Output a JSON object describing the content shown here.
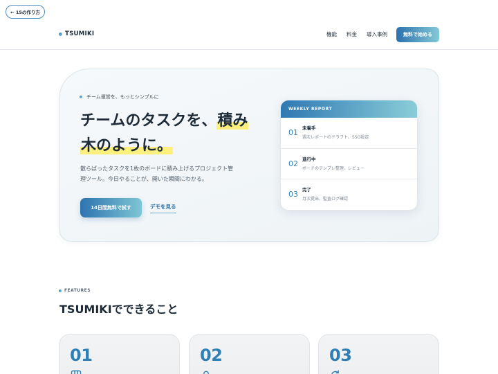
{
  "back_link": {
    "label": "← 15の作り方"
  },
  "header": {
    "logo": "TSUMIKI",
    "nav": [
      {
        "label": "機能"
      },
      {
        "label": "料金"
      },
      {
        "label": "導入事例"
      }
    ],
    "cta_label": "無料で始める"
  },
  "hero": {
    "eyebrow": "チーム運営を、もっとシンプルに",
    "headline": {
      "line1": "チームのタスクを、",
      "line1_highlight": "積み",
      "line2_highlight": "木のように。"
    },
    "description": "散らばったタスクを1枚のボードに積み上げるプロジェクト管理ツール。今日やることが、開いた瞬間にわかる。",
    "primary_cta": "14日間無料で試す",
    "secondary_cta": "デモを見る"
  },
  "weekly_report": {
    "title": "WEEKLY REPORT",
    "rows": [
      {
        "number": "01",
        "status": "未着手",
        "detail": "週次レポートのドラフト、SSO設定"
      },
      {
        "number": "02",
        "status": "進行中",
        "detail": "ボードのテンプレ整理、レビュー"
      },
      {
        "number": "03",
        "status": "完了",
        "detail": "月次提出、監査ログ確認"
      }
    ]
  },
  "features": {
    "eyebrow": "FEATURES",
    "title": "TSUMIKIでできること",
    "cards": [
      {
        "number": "01",
        "icon": "board-icon"
      },
      {
        "number": "02",
        "icon": "user-icon"
      },
      {
        "number": "03",
        "icon": "refresh-icon"
      }
    ]
  },
  "colors": {
    "accent": "#2f7fb5",
    "accent_light": "#86cbd6",
    "highlight": "#fdf07c",
    "text": "#1d2b38"
  }
}
